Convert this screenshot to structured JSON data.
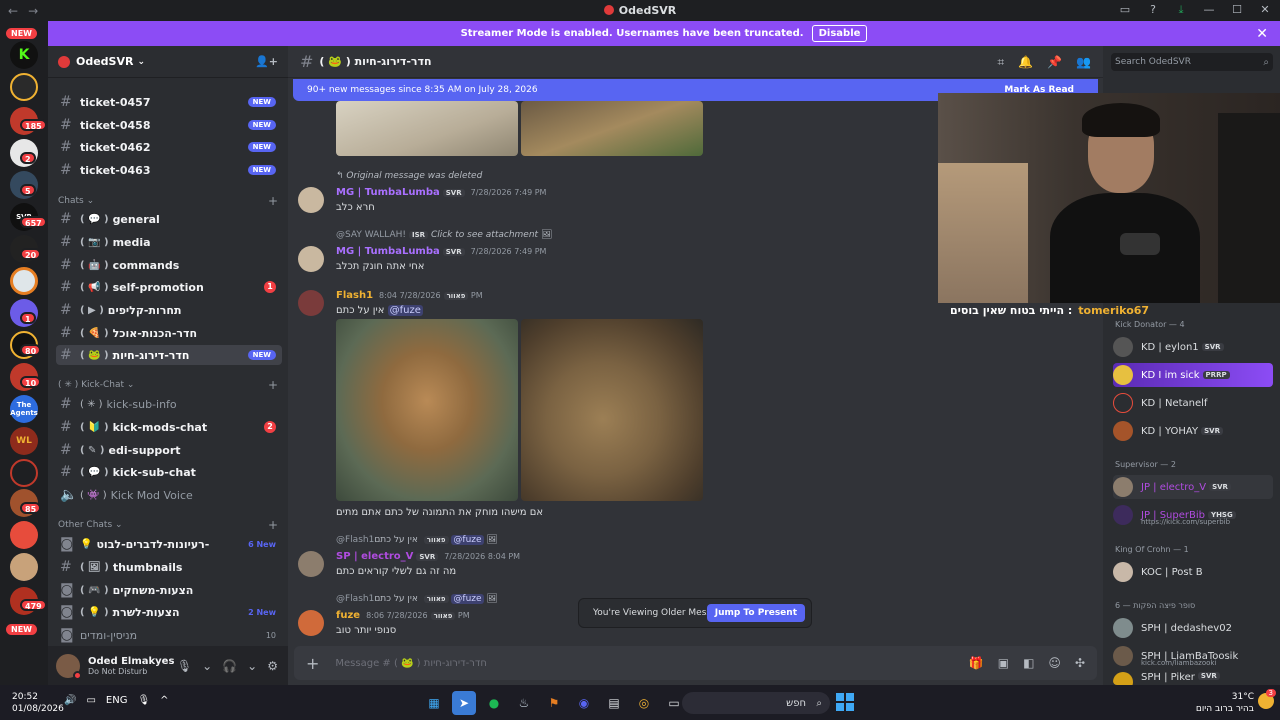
{
  "window": {
    "title": "OdedSVR"
  },
  "banner": {
    "text": "Streamer Mode is enabled. Usernames have been truncated.",
    "button": "Disable"
  },
  "server_rail": {
    "new_top": "NEW",
    "new_bottom": "NEW",
    "badges": [
      "185",
      "2",
      "5",
      "657",
      "20",
      "1",
      "80",
      "10",
      "85",
      "479"
    ],
    "labels": [
      "K",
      "The Agents",
      "WL",
      "SVR"
    ]
  },
  "guild": {
    "name": "OdedSVR"
  },
  "sidebar": {
    "top_channels": [
      {
        "name": "ticket-0457",
        "badge": "NEW"
      },
      {
        "name": "ticket-0458",
        "badge": "NEW"
      },
      {
        "name": "ticket-0462",
        "badge": "NEW"
      },
      {
        "name": "ticket-0463",
        "badge": "NEW"
      }
    ],
    "cat_chats": "Chats",
    "chats": [
      {
        "emoji": "( 💬 )",
        "name": "general"
      },
      {
        "emoji": "( 📷 )",
        "name": "media"
      },
      {
        "emoji": "( 🤖 )",
        "name": "commands"
      },
      {
        "emoji": "( 📢 )",
        "name": "self-promotion",
        "count": "1"
      },
      {
        "emoji": "( ▶ )",
        "name": "תחרות-קליפים"
      },
      {
        "emoji": "( 🍕 )",
        "name": "חדר-הכנות-אוכל"
      },
      {
        "emoji": "( 🐸 )",
        "name": "חדר-דירוג-חיות",
        "badge": "NEW"
      }
    ],
    "cat_kick": "( ✳ )  Kick-Chat",
    "kick": [
      {
        "emoji": "( ✳ )",
        "name": "kick-sub-info"
      },
      {
        "emoji": "( 🔰 )",
        "name": "kick-mods-chat",
        "count": "2"
      },
      {
        "emoji": "( ✎ )",
        "name": "edi-support"
      },
      {
        "emoji": "( 💬 )",
        "name": "kick-sub-chat"
      },
      {
        "emoji": "( 👾 )",
        "name": "Kick Mod Voice"
      }
    ],
    "cat_other": "Other Chats",
    "other": [
      {
        "emoji": "💡",
        "name": "רעיונות-לדברים-לבוט-",
        "extra": "6 New"
      },
      {
        "emoji": "( 🖼 )",
        "name": "thumbnails"
      },
      {
        "emoji": "( 🎮 )",
        "name": "הצעות-משחקים"
      },
      {
        "emoji": "( 💡 )",
        "name": "הצעות-לשרת",
        "extra": "2 New"
      },
      {
        "emoji": "",
        "name": "מניסין-ומדים",
        "extra": "10"
      }
    ]
  },
  "user": {
    "name": "Oded Elmakyes",
    "status": "Do Not Disturb"
  },
  "chat": {
    "channel": "( 🐸 ) חדר-דירוג-חיות",
    "new_messages": "90+ new messages since 8:35 AM on July 28, 2026",
    "mark_read": "Mark As Read",
    "messages": [
      {
        "reply": "Original message was deleted",
        "author": "MG | TumbaLumba",
        "tag": "SVR",
        "time": "7/28/2026 7:49 PM",
        "text": "חרא כלב"
      },
      {
        "reply_author": "@SAY WALLAH!",
        "reply_tag": "ISR",
        "reply": "Click to see attachment",
        "author": "MG | TumbaLumba",
        "tag": "SVR",
        "time": "7/28/2026 7:49 PM",
        "text": "אחי אתה חונק תכלב"
      },
      {
        "author": "Flash1",
        "tag": "פאוור",
        "time": "7/28/2026 8:04 PM",
        "text": "אין על כתם",
        "mention": "@fuze",
        "caption": "אם מישהו מוחק את התמונה של כתם אתם מתים"
      },
      {
        "reply_author": "@Flash1",
        "reply_tag": "פאוור",
        "reply": "אין על כתם",
        "reply_mention": "@fuze",
        "author": "SP | electro_V",
        "tag": "SVR",
        "time": "7/28/2026 8:04 PM",
        "text": "מה זה גם לשלי קוראים כתם"
      },
      {
        "reply_author": "@Flash1",
        "reply_tag": "פאוור",
        "reply": "אין על כתם",
        "reply_mention": "@fuze",
        "author": "fuze",
        "tag": "פאוור",
        "time": "7/28/2026 8:06 PM",
        "text": "סנופי יותר טוב"
      }
    ],
    "older_text": "You're Viewing Older Messages",
    "jump": "Jump To Present",
    "composer_placeholder": "Message # ( 🐸 ) חדר-דירוג-חיות"
  },
  "members": {
    "search_placeholder": "Search OdedSVR",
    "groups": [
      {
        "title": "Kick Donator — 4",
        "members": [
          {
            "name": "KD | eylon1",
            "tag": "SVR",
            "color": "#dbdee1"
          },
          {
            "name": "KD I im sick",
            "tag": "PRRP",
            "color": "#ffffff",
            "highlight": true
          },
          {
            "name": "KD | Netanelf",
            "color": "#dbdee1"
          },
          {
            "name": "KD | YOHAY",
            "tag": "SVR",
            "color": "#dbdee1"
          }
        ]
      },
      {
        "title": "Supervisor — 2",
        "members": [
          {
            "name": "JP | electro_V",
            "tag": "SVR",
            "color": "#b04ce0"
          },
          {
            "name": "JP | SuperBib",
            "tag": "YHSG",
            "sub": "https://kick.com/superbib",
            "color": "#b04ce0"
          }
        ]
      },
      {
        "title": "King Of Crohn — 1",
        "members": [
          {
            "name": "KOC | Post B",
            "color": "#dbdee1"
          }
        ]
      },
      {
        "title": "סופר פיצה הפקות — 6",
        "members": [
          {
            "name": "SPH | dedashev02",
            "color": "#dbdee1"
          },
          {
            "name": "SPH | LiamBaToosik",
            "sub": "kick.com/liambazooki",
            "color": "#dbdee1"
          },
          {
            "name": "SPH | Piker",
            "tag": "SVR",
            "color": "#dbdee1"
          }
        ]
      }
    ]
  },
  "stream_overlay": {
    "user": "tomeriko67",
    "message": "הייתי בטוח שאין בוסים :"
  },
  "taskbar": {
    "time": "20:52",
    "date": "01/08/2026",
    "lang": "ENG",
    "search": "חפש",
    "temp": "31°C",
    "weather": "בהיר ברוב היום",
    "weather_badge": "3"
  }
}
